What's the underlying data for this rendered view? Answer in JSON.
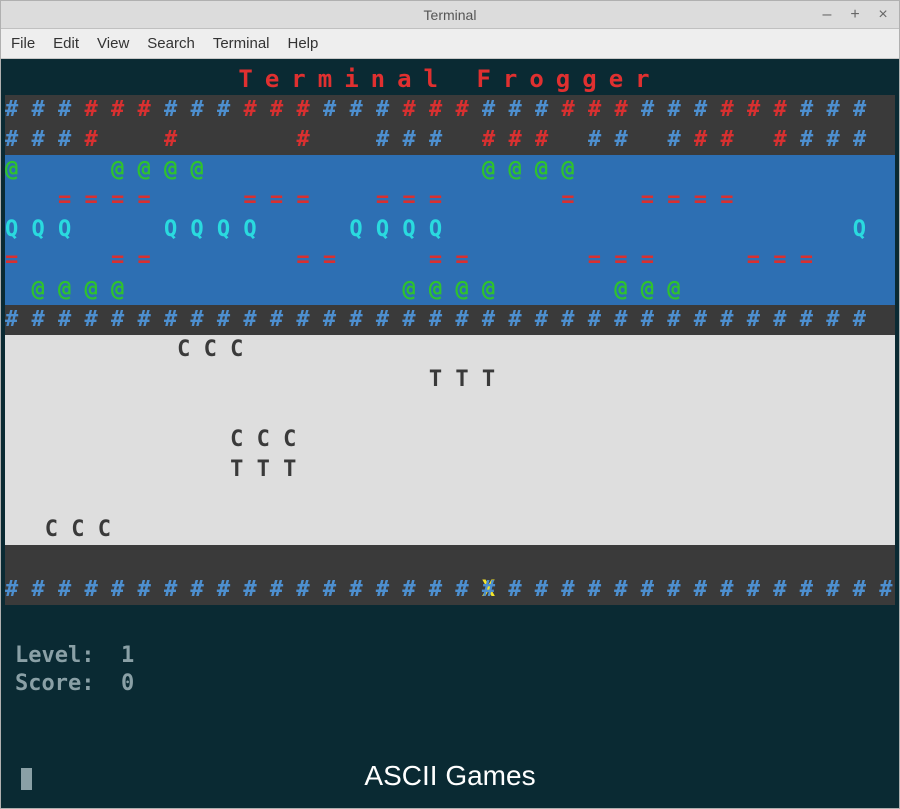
{
  "window": {
    "title": "Terminal",
    "controls": {
      "min": "–",
      "max": "+",
      "close": "×"
    }
  },
  "menu": {
    "file": "File",
    "edit": "Edit",
    "view": "View",
    "search": "Search",
    "terminal": "Terminal",
    "help": "Help"
  },
  "game": {
    "title": "Terminal Frogger",
    "bank_top_1": "# # # # # # # # # # # # # # # # # # # # # # # # # # # # # # # # #",
    "bank_top_2": "# # # #     #         #     # # #   # # #   # #   # # #   # # # #",
    "river": {
      "r1": "@       @ @ @ @                     @ @ @ @     ",
      "r2": "    = = = =       = = =     = = =         =     = = = =         ",
      "r3": "Q Q Q       Q Q Q Q       Q Q Q Q                               Q",
      "r4": "=       = =           = =       = =         = = =       = = =    ",
      "r5": "  @ @ @ @                     @ @ @ @         @ @ @     "
    },
    "bank_mid": "# # # # # # # # # # # # # # # # # # # # # # # # # # # # # # # # #",
    "road": {
      "r1": "             C C C                                              ",
      "r2": "                                T T T                           ",
      "r3": "                                                                ",
      "r4": "                 C C C                                          ",
      "r5": "                 T T T                                          ",
      "r6": "                                                                ",
      "r7": "   C C C                                                        "
    },
    "bank_bot_1_left": "# # # # # # # # # # # # # # #",
    "bank_bot_1_frog": " X ",
    "bank_bot_1_right": "# # # # # # # # # # # # # # # # #",
    "bank_bot_2": "# # # # # # # # # # # # # # # # # # # # # # # # # # # # # # # # #",
    "status": {
      "level_label": "Level:  ",
      "level_value": "1",
      "score_label": "Score:  ",
      "score_value": "0"
    }
  },
  "caption": "ASCII Games",
  "colors": {
    "bg_terminal": "#0a2a33",
    "bank": "#3a3a3a",
    "water": "#2d6fb3",
    "road": "#dedede",
    "hash_blue": "#4d8fcf",
    "hash_red": "#d83030",
    "log_green": "#2ec22e",
    "turtle_cyan": "#2adadf",
    "wave_red": "#d83030",
    "frog_yellow": "#f5e52a",
    "car_dark": "#3a3a3a",
    "status_gray": "#8aa0a6",
    "title_red": "#e03030"
  }
}
